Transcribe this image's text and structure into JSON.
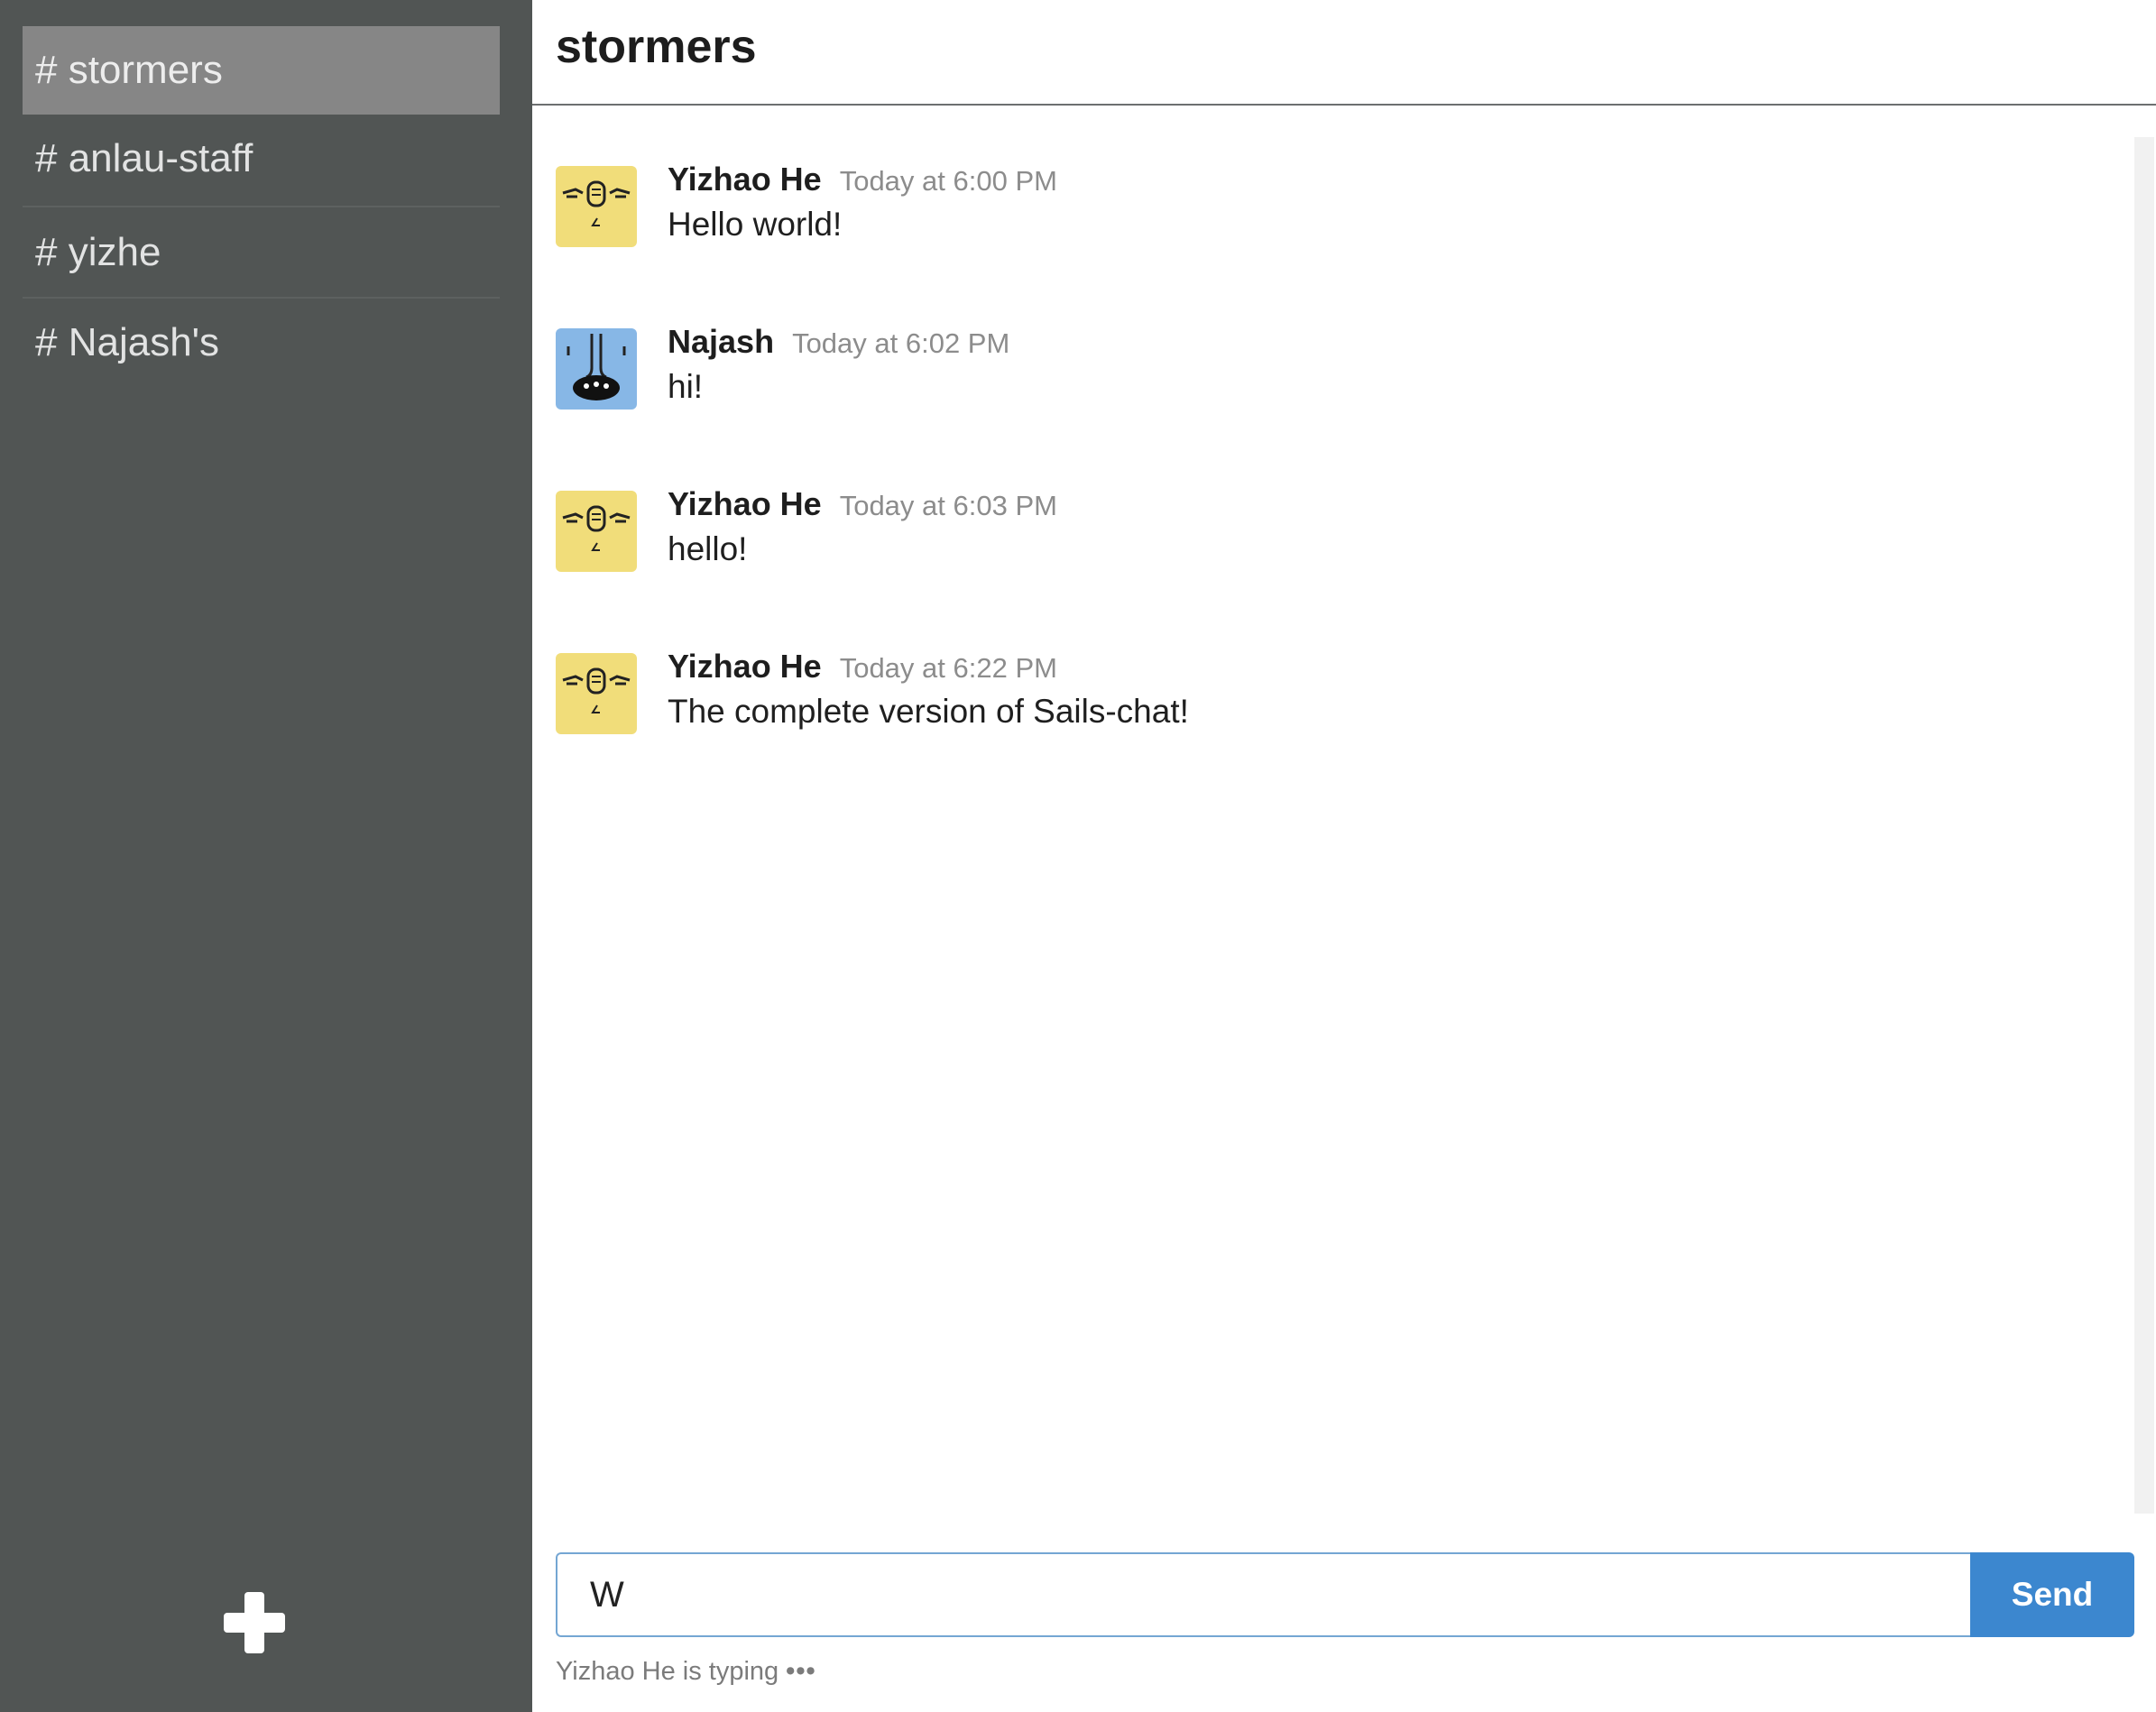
{
  "sidebar": {
    "channels": [
      {
        "label": "# stormers",
        "active": true
      },
      {
        "label": "# anlau-staff",
        "active": false
      },
      {
        "label": "# yizhe",
        "active": false
      },
      {
        "label": "# Najash's",
        "active": false
      }
    ],
    "add_icon": "plus-icon"
  },
  "header": {
    "title": "stormers"
  },
  "messages": [
    {
      "author": "Yizhao He",
      "time": "Today at 6:00 PM",
      "text": "Hello world!",
      "avatar_color": "#f1dd7a"
    },
    {
      "author": "Najash",
      "time": "Today at 6:02 PM",
      "text": "hi!",
      "avatar_color": "#87b7e6"
    },
    {
      "author": "Yizhao He",
      "time": "Today at 6:03 PM",
      "text": "hello!",
      "avatar_color": "#f1dd7a"
    },
    {
      "author": "Yizhao He",
      "time": "Today at 6:22 PM",
      "text": "The complete version of Sails-chat!",
      "avatar_color": "#f1dd7a"
    }
  ],
  "composer": {
    "value": "W",
    "send_label": "Send"
  },
  "typing_indicator": {
    "text": "Yizhao He is typing",
    "dots": "•••"
  },
  "colors": {
    "sidebar_bg": "#515554",
    "active_channel_bg": "#868686",
    "accent": "#3c87cf"
  }
}
